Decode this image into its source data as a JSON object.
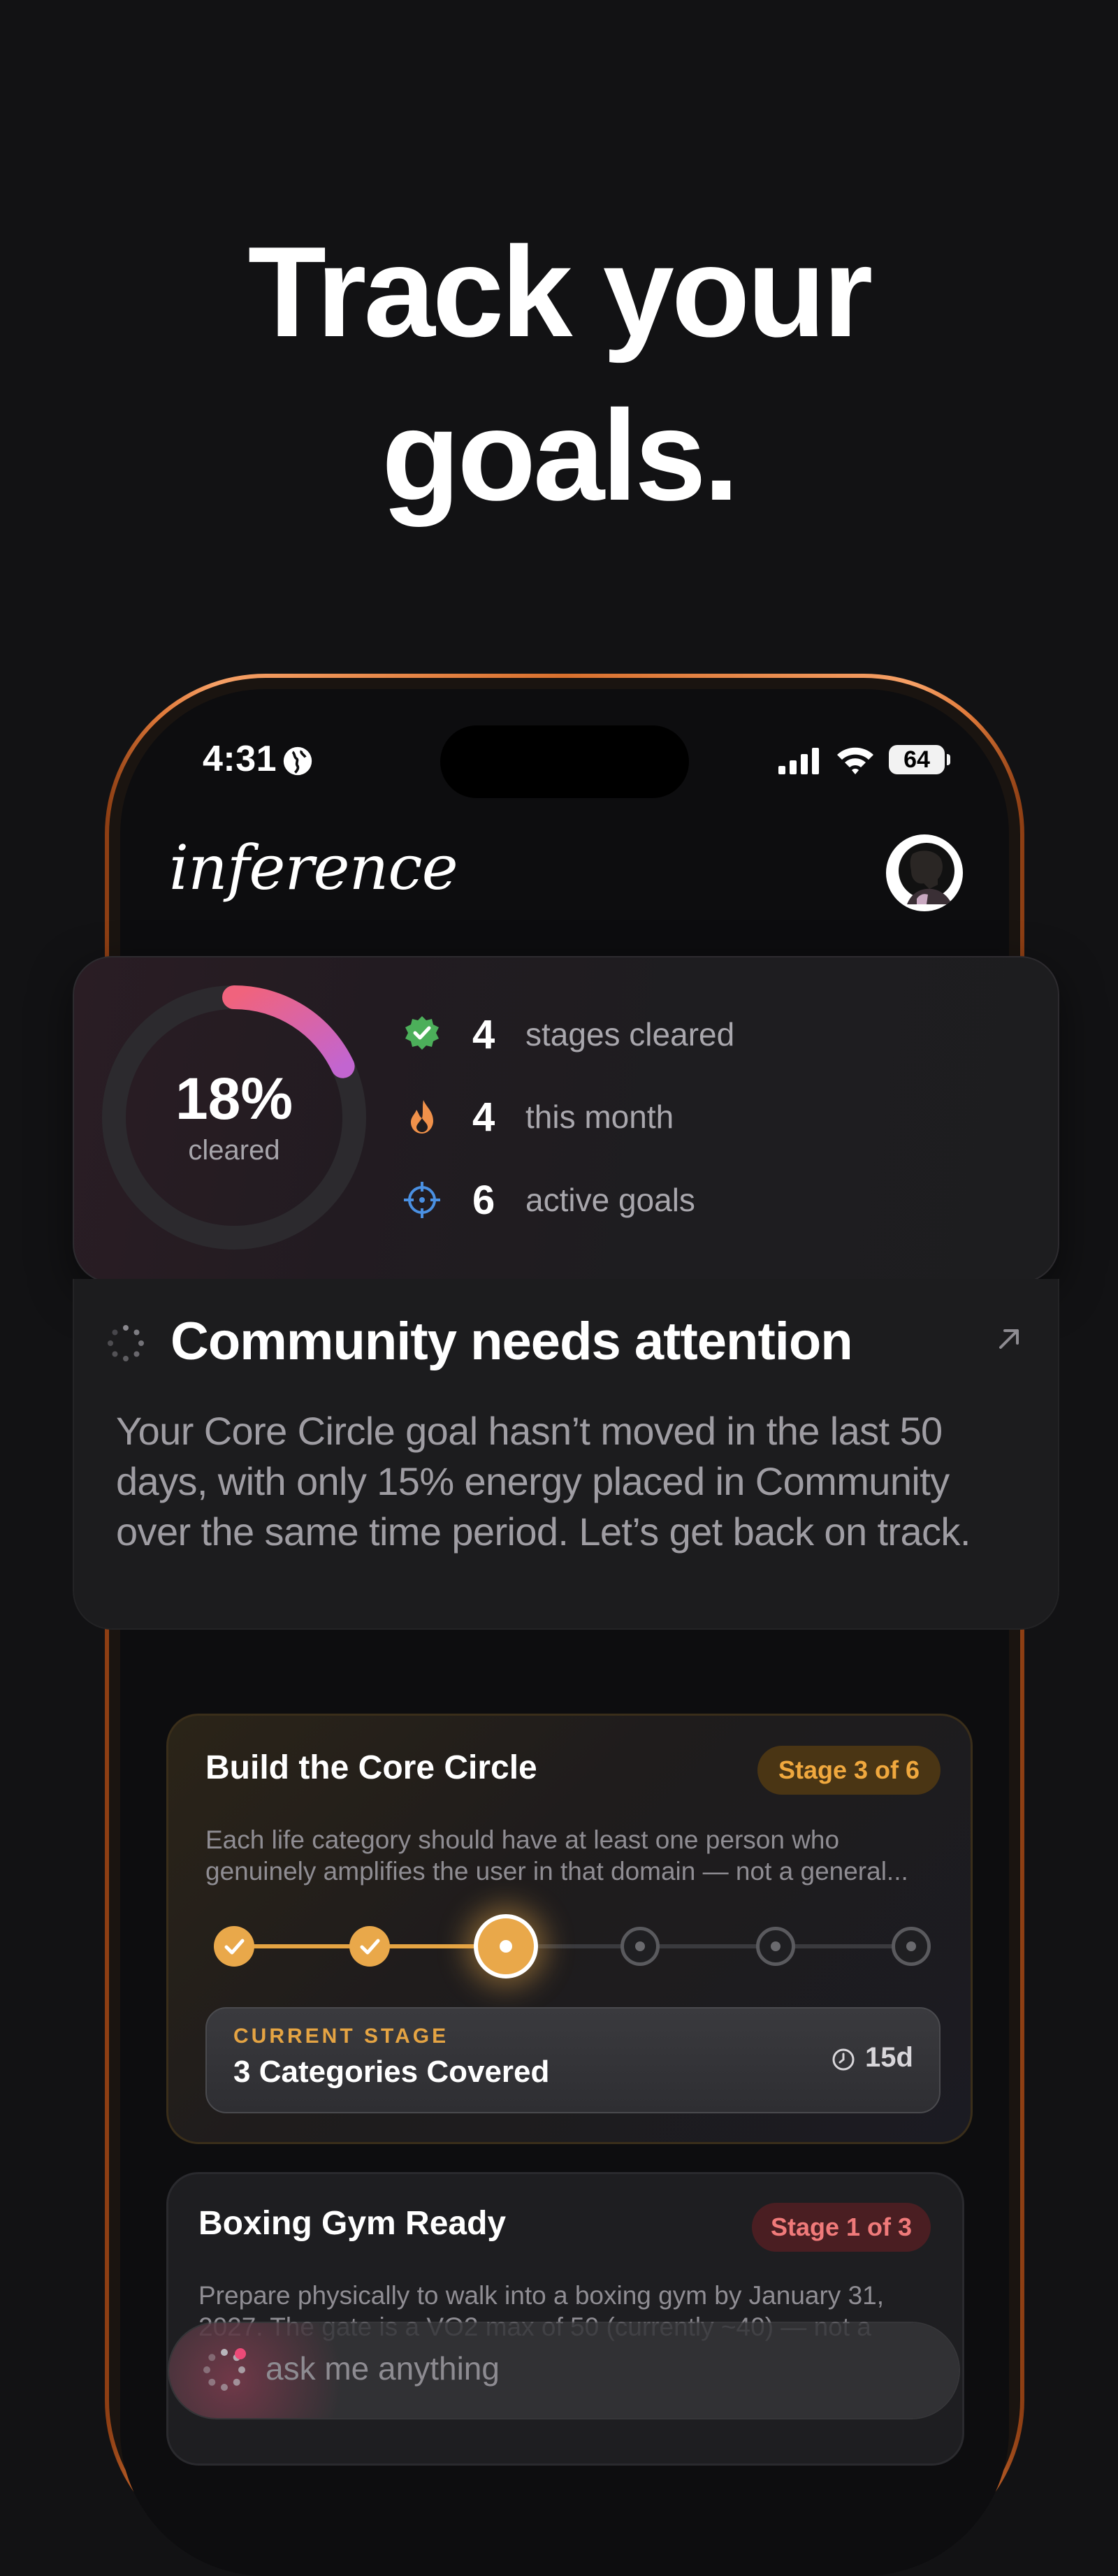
{
  "headline": {
    "line1": "Track your",
    "line2": "goals."
  },
  "status_bar": {
    "time": "4:31",
    "battery": "64"
  },
  "app": {
    "brand": "inference"
  },
  "stats": {
    "cleared_percent": "18%",
    "cleared_fraction": 0.18,
    "cleared_label": "cleared",
    "rows": [
      {
        "icon": "verified-badge-icon",
        "value": "4",
        "label": "stages cleared"
      },
      {
        "icon": "flame-icon",
        "value": "4",
        "label": "this month"
      },
      {
        "icon": "target-icon",
        "value": "6",
        "label": "active goals"
      }
    ]
  },
  "insight": {
    "title": "Community needs attention",
    "body": "Your Core Circle goal hasn’t moved in the last 50 days, with only 15% energy placed in Community over the same time period. Let’s get back on track."
  },
  "goals": [
    {
      "title": "Build the Core Circle",
      "stage": "Stage 3 of 6",
      "description_line1": "Each life category should have at least one person who",
      "description_line2": "genuinely amplifies the user in that domain — not a general...",
      "current_stage_kicker": "CURRENT STAGE",
      "current_stage_name": "3 Categories Covered",
      "days": "15d",
      "stages_total": 6,
      "stages_completed": 2
    },
    {
      "title": "Boxing Gym Ready",
      "stage": "Stage 1 of 3",
      "description_line1": "Prepare physically to walk into a boxing gym by January 31,",
      "description_line2": "2027. The gate is a VO2 max of 50 (currently ~40) — not a"
    }
  ],
  "ask": {
    "placeholder": "ask me anything"
  },
  "colors": {
    "accent_gold": "#e9a84a",
    "accent_pink": "#e65c8c",
    "phone_frame": "#e07a3a",
    "goal2_stage": "#f07a7a"
  }
}
